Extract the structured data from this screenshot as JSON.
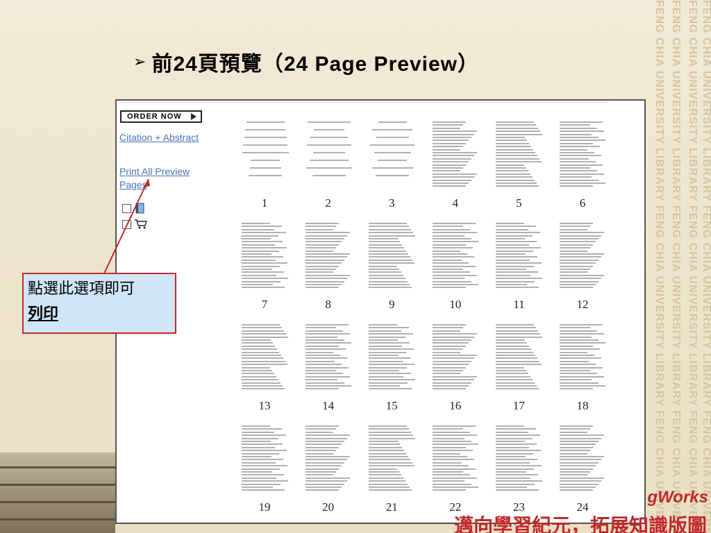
{
  "slide": {
    "title_bullet": "➢",
    "title_cjk_a": "前",
    "title_num": "24",
    "title_cjk_b": "頁預覽（",
    "title_latin": "24 Page Preview",
    "title_close": "）",
    "watermark_text": "FENG CHIA UNIVERSITY LIBRARY FENG CHIA UNIVERSITY LIBRARY FENG CHIA UNIVERSITY LIBRARY"
  },
  "preview": {
    "order_label": "ORDER NOW",
    "citation_link": "Citation + Abstract",
    "print_link": "Print All Preview Pages",
    "icons": [
      "book-icon",
      "cart-icon"
    ],
    "pages": [
      "1",
      "2",
      "3",
      "4",
      "5",
      "6",
      "7",
      "8",
      "9",
      "10",
      "11",
      "12",
      "13",
      "14",
      "15",
      "16",
      "17",
      "18",
      "19",
      "20",
      "21",
      "22",
      "23",
      "24"
    ]
  },
  "callout": {
    "line1": "點選此選項即可",
    "line2": "列印"
  },
  "brand": {
    "works": "gWorks",
    "sub": "邁向學習紀元，拓展知識版圖"
  },
  "colors": {
    "callout_border": "#c0282b",
    "callout_bg": "#cfe6f7",
    "link": "#4a73b8",
    "brand_red": "#c0282b"
  }
}
